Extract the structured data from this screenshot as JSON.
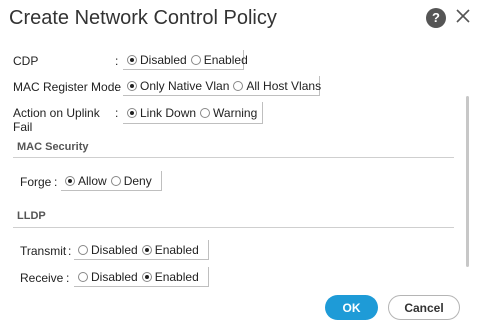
{
  "dialog": {
    "title": "Create Network Control Policy",
    "help_label": "?"
  },
  "fields": {
    "cdp": {
      "label": "CDP",
      "colon": ":",
      "options": [
        "Disabled",
        "Enabled"
      ],
      "selected": 0
    },
    "mac_register_mode": {
      "label": "MAC Register Mode",
      "colon": ":",
      "options": [
        "Only Native Vlan",
        "All Host Vlans"
      ],
      "selected": 0
    },
    "action_on_uplink_fail": {
      "label": "Action on Uplink Fail",
      "colon": ":",
      "options": [
        "Link Down",
        "Warning"
      ],
      "selected": 0
    }
  },
  "mac_security": {
    "heading": "MAC Security",
    "forge": {
      "label": "Forge",
      "colon": ":",
      "options": [
        "Allow",
        "Deny"
      ],
      "selected": 0
    }
  },
  "lldp": {
    "heading": "LLDP",
    "transmit": {
      "label": "Transmit",
      "colon": ":",
      "options": [
        "Disabled",
        "Enabled"
      ],
      "selected": 1
    },
    "receive": {
      "label": "Receive",
      "colon": ":",
      "options": [
        "Disabled",
        "Enabled"
      ],
      "selected": 1
    }
  },
  "buttons": {
    "ok": "OK",
    "cancel": "Cancel"
  },
  "colors": {
    "primary": "#1e9bd7"
  }
}
